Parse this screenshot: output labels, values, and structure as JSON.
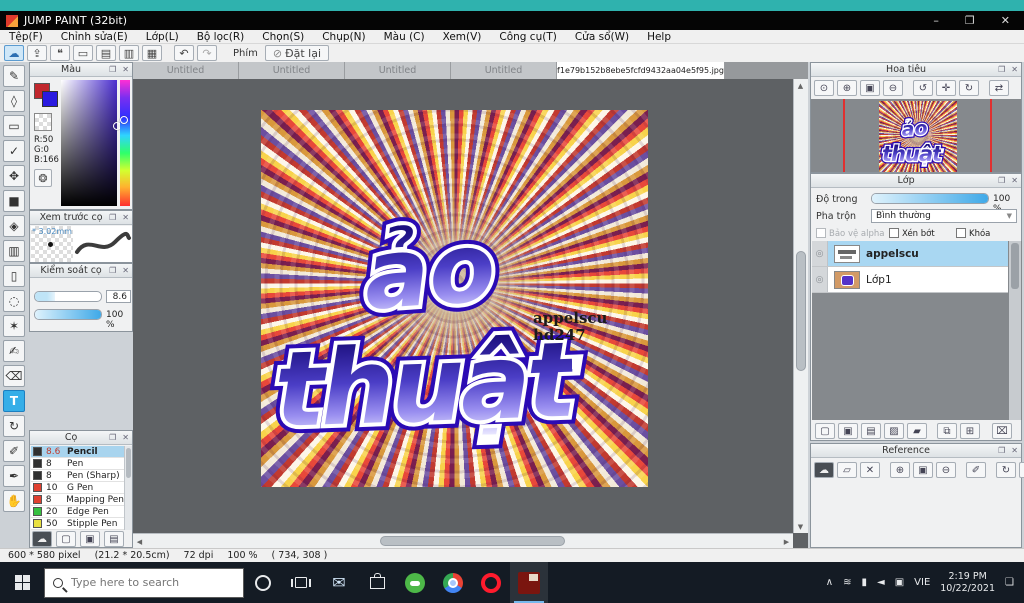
{
  "window": {
    "title": "JUMP PAINT (32bit)",
    "minimize": "–",
    "maximize": "❐",
    "close": "✕"
  },
  "menus": [
    "Tệp(F)",
    "Chỉnh sửa(E)",
    "Lớp(L)",
    "Bộ lọc(R)",
    "Chọn(S)",
    "Chụp(N)",
    "Màu (C)",
    "Xem(V)",
    "Công cụ(T)",
    "Cửa sổ(W)",
    "Help"
  ],
  "toolbar": {
    "buttons": [
      {
        "name": "cloud",
        "glyph": "☁"
      },
      {
        "name": "export",
        "glyph": "⇪"
      },
      {
        "name": "comment",
        "glyph": "❝"
      },
      {
        "name": "monitor",
        "glyph": "▭"
      },
      {
        "name": "document",
        "glyph": "▤"
      },
      {
        "name": "layout-list",
        "glyph": "▥"
      },
      {
        "name": "grid-palette",
        "glyph": "▦"
      }
    ],
    "undo": "↶",
    "redo": "↷",
    "phim": "Phím",
    "reset": "Đặt lại",
    "reset_icon": "⊘"
  },
  "tools": [
    {
      "name": "brush",
      "glyph": "✎"
    },
    {
      "name": "eraser",
      "glyph": "◊"
    },
    {
      "name": "shape",
      "glyph": "▭"
    },
    {
      "name": "curve",
      "glyph": "✓"
    },
    {
      "name": "move",
      "glyph": "✥"
    },
    {
      "name": "tone",
      "glyph": "■"
    },
    {
      "name": "bucket-fill",
      "glyph": "◈"
    },
    {
      "name": "gradient",
      "glyph": "▥"
    },
    {
      "name": "select-rectangle",
      "glyph": "▯"
    },
    {
      "name": "select-lasso",
      "glyph": "◌"
    },
    {
      "name": "magic-wand",
      "glyph": "✶"
    },
    {
      "name": "select-pen",
      "glyph": "✍"
    },
    {
      "name": "select-eraser",
      "glyph": "⌫"
    },
    {
      "name": "text",
      "glyph": "T"
    },
    {
      "name": "rotate-view",
      "glyph": "↻"
    },
    {
      "name": "eyedropper",
      "glyph": "✐"
    },
    {
      "name": "line-pen",
      "glyph": "✒"
    },
    {
      "name": "hand",
      "glyph": "✋"
    }
  ],
  "color_panel": {
    "title": "Màu",
    "r": "R:50",
    "g": "G:0",
    "b": "B:166",
    "palette_icon": "❂"
  },
  "brush_preview": {
    "title": "Xem trước cọ",
    "size": "* 3.02mm"
  },
  "brush_control": {
    "title": "Kiểm soát cọ",
    "size_value": "8.6",
    "opacity_value": "100 %"
  },
  "brush_panel": {
    "title": "Cọ",
    "brushes": [
      {
        "size": "8.6",
        "name": "Pencil",
        "color": "#303030",
        "selected": true
      },
      {
        "size": "8",
        "name": "Pen",
        "color": "#303030"
      },
      {
        "size": "8",
        "name": "Pen (Sharp)",
        "color": "#303030"
      },
      {
        "size": "10",
        "name": "G Pen",
        "color": "#e04030"
      },
      {
        "size": "8",
        "name": "Mapping Pen",
        "color": "#e04030"
      },
      {
        "size": "20",
        "name": "Edge Pen",
        "color": "#35c040"
      },
      {
        "size": "50",
        "name": "Stipple Pen",
        "color": "#e8e040"
      }
    ],
    "buttons": [
      {
        "name": "upload-brush",
        "glyph": "☁"
      },
      {
        "name": "new-brush",
        "glyph": "▢"
      },
      {
        "name": "new-brush-menu",
        "glyph": "▣"
      },
      {
        "name": "script-brush",
        "glyph": "▤"
      }
    ]
  },
  "tabs": [
    "Untitled",
    "Untitled",
    "Untitled",
    "Untitled",
    "f1e79b152b8ebe5fcfd9432aa04e5f95.jpg"
  ],
  "canvas": {
    "word1": "ảo",
    "word2": "thuật",
    "watermark_line1": "appelscu",
    "watermark_line2": "hd247"
  },
  "navigator": {
    "title": "Hoa tiêu",
    "buttons": [
      {
        "name": "zoom-actual",
        "glyph": "⊙"
      },
      {
        "name": "zoom-in",
        "glyph": "⊕"
      },
      {
        "name": "fit-window",
        "glyph": "▣"
      },
      {
        "name": "zoom-out",
        "glyph": "⊖"
      },
      {
        "name": "rotate-left",
        "glyph": "↺"
      },
      {
        "name": "reset-rotation",
        "glyph": "✛"
      },
      {
        "name": "rotate-right",
        "glyph": "↻"
      },
      {
        "name": "flip-horizontal",
        "glyph": "⇄"
      }
    ]
  },
  "layers": {
    "title": "Lớp",
    "opacity_label": "Độ trong",
    "opacity_value": "100 %",
    "blend_label": "Pha trộn",
    "blend_value": "Bình thường",
    "cb_alpha": "Bảo vệ alpha",
    "cb_clip": "Xén bớt",
    "cb_lock": "Khóa",
    "items": [
      {
        "name": "appelscu"
      },
      {
        "name": "Lớp1"
      }
    ],
    "buttons": [
      {
        "name": "new-layer",
        "glyph": "▢"
      },
      {
        "name": "new-layer-alpha",
        "glyph": "▣"
      },
      {
        "name": "new-layer-1bit",
        "glyph": "▤"
      },
      {
        "name": "new-halftone-layer",
        "glyph": "▨"
      },
      {
        "name": "new-folder",
        "glyph": "▰"
      },
      {
        "name": "duplicate-layer",
        "glyph": "⧉"
      },
      {
        "name": "merge-layer",
        "glyph": "⊞"
      },
      {
        "name": "delete-layer",
        "glyph": "⌧"
      }
    ]
  },
  "reference": {
    "title": "Reference",
    "buttons": [
      {
        "name": "upload-reference",
        "glyph": "☁"
      },
      {
        "name": "open-folder",
        "glyph": "▱"
      },
      {
        "name": "close-reference",
        "glyph": "✕"
      },
      {
        "name": "zoom-in",
        "glyph": "⊕"
      },
      {
        "name": "fit",
        "glyph": "▣"
      },
      {
        "name": "zoom-out",
        "glyph": "⊖"
      },
      {
        "name": "edit-pen",
        "glyph": "✐"
      },
      {
        "name": "rotate",
        "glyph": "↻"
      },
      {
        "name": "fit-width",
        "glyph": "⇔"
      }
    ]
  },
  "panel_header_icons": {
    "popout": "❐",
    "close": "✕"
  },
  "status": {
    "size": "600 * 580 pixel",
    "cm": "(21.2 * 20.5cm)",
    "dpi": "72 dpi",
    "zoom": "100 %",
    "pos": "( 734, 308 )"
  },
  "taskbar": {
    "search_placeholder": "Type here to search",
    "language": "VIE",
    "time": "2:19 PM",
    "date": "10/22/2021",
    "tray": [
      {
        "name": "chevron-up",
        "glyph": "∧"
      },
      {
        "name": "wifi",
        "glyph": "≋"
      },
      {
        "name": "battery",
        "glyph": "▮"
      },
      {
        "name": "volume",
        "glyph": "◄"
      },
      {
        "name": "tray-app",
        "glyph": "▣"
      },
      {
        "name": "notification",
        "glyph": "❏"
      }
    ]
  },
  "colors": {
    "accent_selection": "#a9d7f2",
    "tool_active": "#35aee8",
    "taskbar_bg": "#141b24",
    "teal_edge": "#2fb2ae",
    "canvas_bg": "#5e6164",
    "bubble_outline": "#2b0bb4",
    "current_color_blue": "#2a1ae0",
    "swatch_red": "#c1272d"
  }
}
